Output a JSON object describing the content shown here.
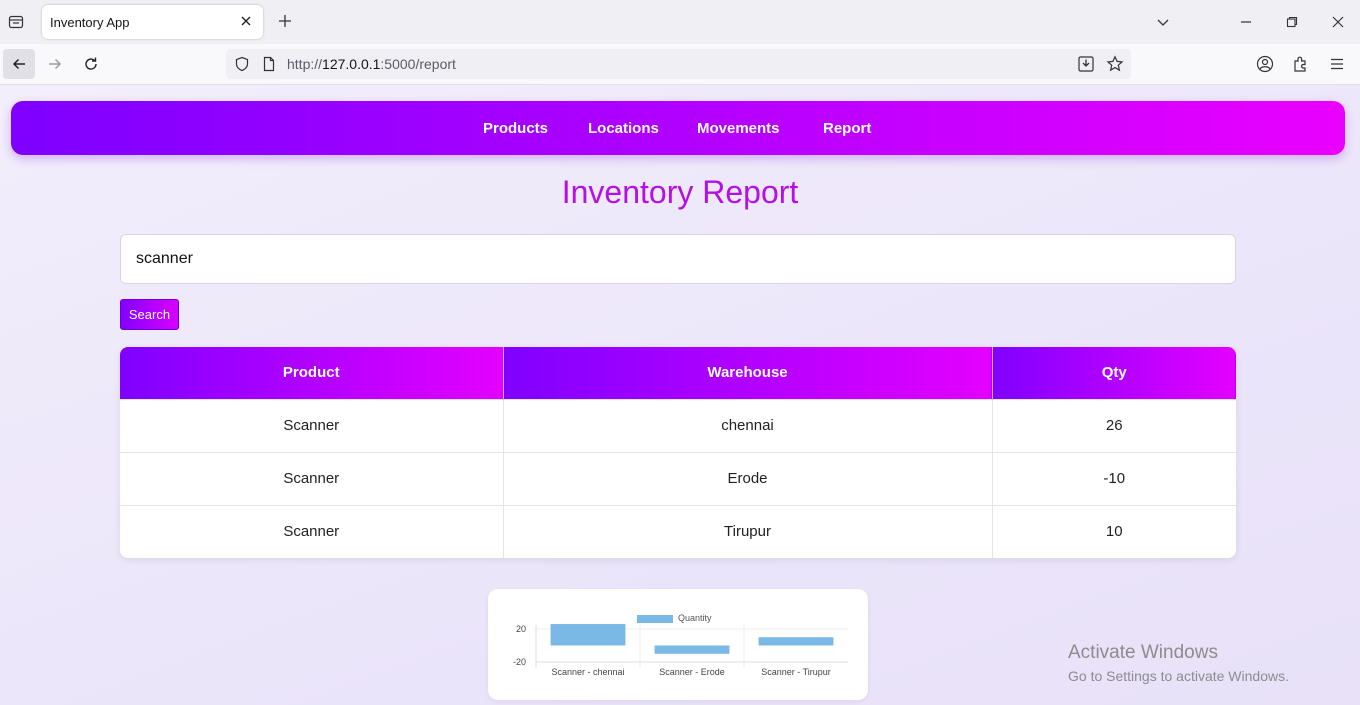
{
  "browser": {
    "tab_title": "Inventory App",
    "url_prefix": "http://",
    "url_host": "127.0.0.1",
    "url_path": ":5000/report"
  },
  "nav": {
    "items": [
      "Products",
      "Locations",
      "Movements",
      "Report"
    ]
  },
  "page_title": "Inventory Report",
  "search": {
    "value": "scanner",
    "button_label": "Search"
  },
  "table": {
    "headers": [
      "Product",
      "Warehouse",
      "Qty"
    ],
    "rows": [
      [
        "Scanner",
        "chennai",
        "26"
      ],
      [
        "Scanner",
        "Erode",
        "-10"
      ],
      [
        "Scanner",
        "Tirupur",
        "10"
      ]
    ]
  },
  "chart_data": {
    "type": "bar",
    "categories": [
      "Scanner - chennai",
      "Scanner - Erode",
      "Scanner - Tirupur"
    ],
    "series": [
      {
        "name": "Quantity",
        "values": [
          26,
          -10,
          10
        ],
        "color": "#7ab8e6"
      }
    ],
    "yticks": [
      "20",
      "-20"
    ],
    "ylim": [
      -20,
      20
    ],
    "grid": true,
    "legend": "top-center"
  },
  "watermark": {
    "line1": "Activate Windows",
    "line2": "Go to Settings to activate Windows."
  },
  "colors": {
    "accent_start": "#8000ff",
    "accent_end": "#e400ff",
    "title": "#b310e8"
  }
}
